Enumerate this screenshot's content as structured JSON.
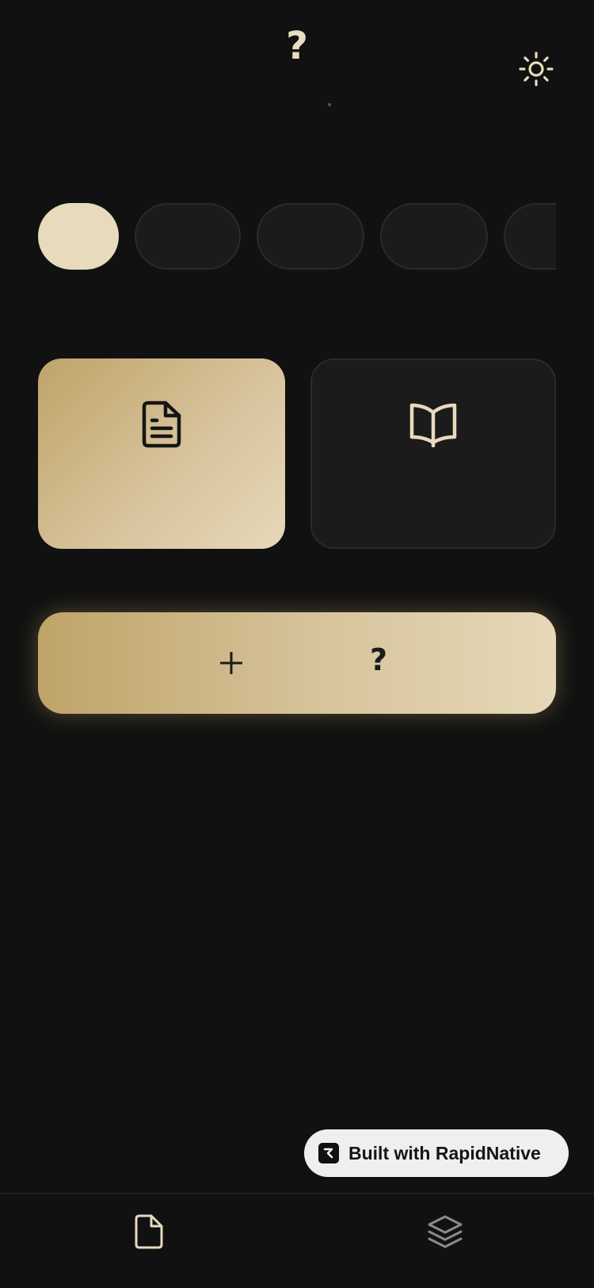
{
  "header": {
    "title": "?"
  },
  "chips": [
    {
      "label": "",
      "active": true
    },
    {
      "label": "",
      "active": false
    },
    {
      "label": "",
      "active": false
    },
    {
      "label": "",
      "active": false
    },
    {
      "label": "",
      "active": false
    }
  ],
  "cards": [
    {
      "icon": "document-text-icon",
      "label": ""
    },
    {
      "icon": "book-open-icon",
      "label": ""
    }
  ],
  "create_button": {
    "icon": "plus-icon",
    "label": "?"
  },
  "badge": {
    "text": "Built with RapidNative",
    "icon": "rapidnative-logo-icon"
  },
  "tabbar": {
    "items": [
      {
        "icon": "file-icon",
        "active": true
      },
      {
        "icon": "layers-icon",
        "active": false
      }
    ]
  },
  "colors": {
    "background": "#111111",
    "accent": "#e7dabd",
    "gold_start": "#bfa469",
    "gold_end": "#e7d8b8",
    "card_dark": "#1b1b1b"
  }
}
